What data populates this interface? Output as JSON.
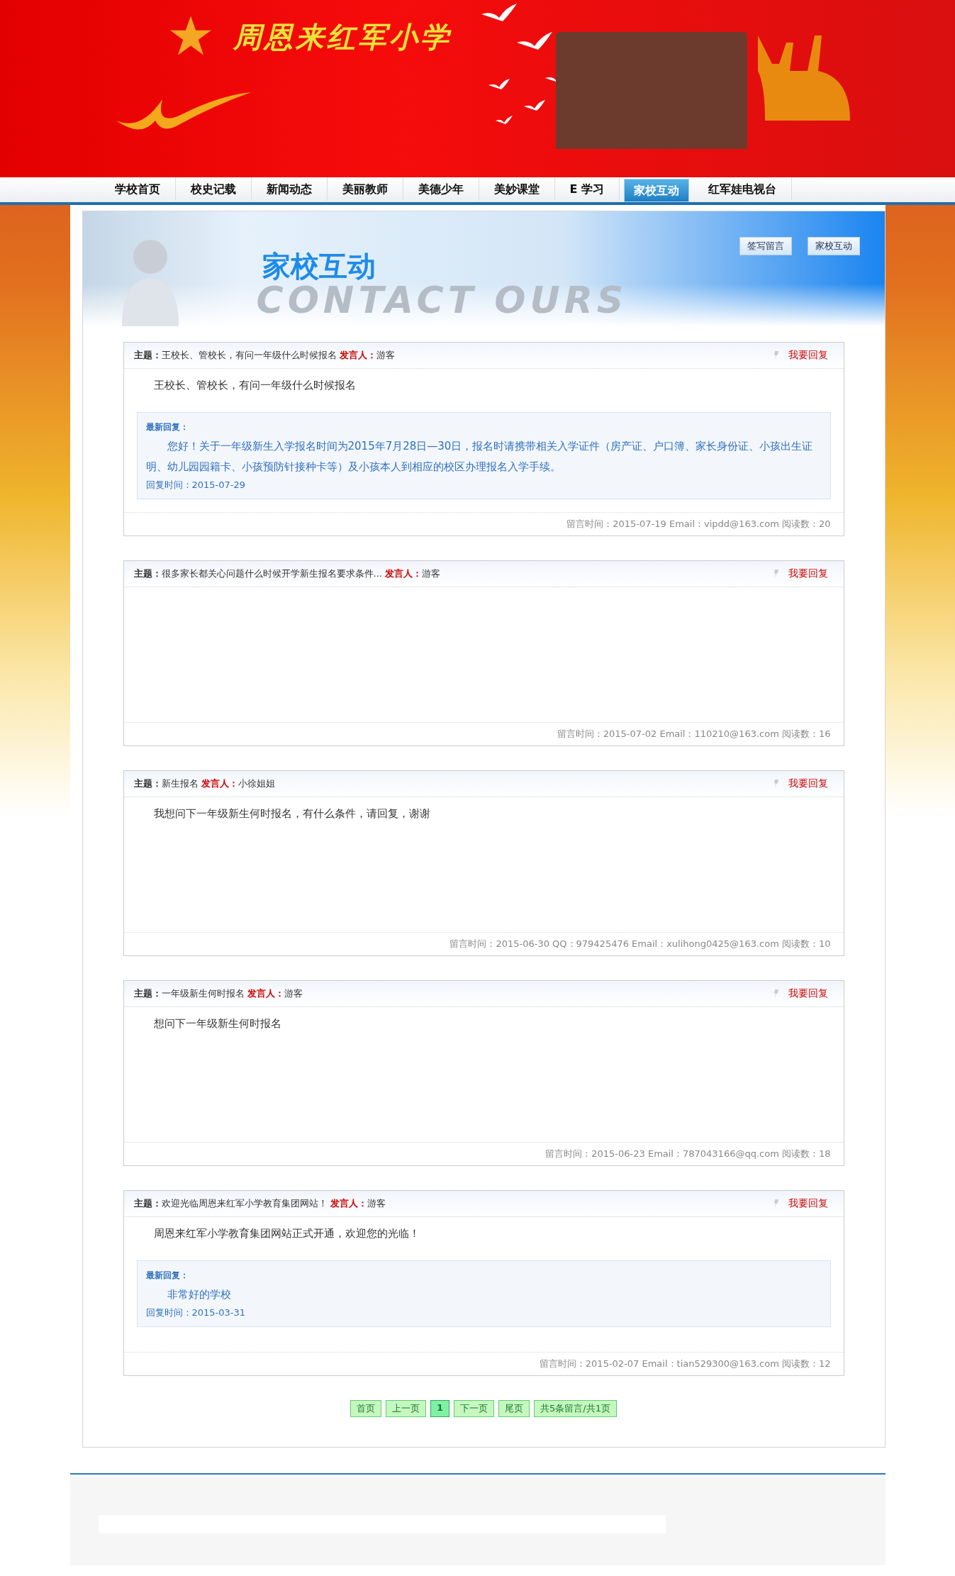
{
  "header": {
    "school_name": "周恩来红军小学"
  },
  "nav": [
    {
      "label": "学校首页",
      "selected": false
    },
    {
      "label": "校史记载",
      "selected": false
    },
    {
      "label": "新闻动态",
      "selected": false
    },
    {
      "label": "美丽教师",
      "selected": false
    },
    {
      "label": "美德少年",
      "selected": false
    },
    {
      "label": "美妙课堂",
      "selected": false
    },
    {
      "label": "E 学习",
      "selected": false
    },
    {
      "label": "家校互动",
      "selected": true
    },
    {
      "label": "红军娃电视台",
      "selected": false
    }
  ],
  "banner": {
    "title": "家校互动",
    "subtitle": "CONTACT  OURS",
    "buttons": [
      "签写留言",
      "家校互动"
    ]
  },
  "posts": [
    {
      "subject_label": "主题：",
      "subject": "王校长、管校长，有问一年级什么时候报名",
      "author_label": "发言人：",
      "author": "游客",
      "reply_link": "我要回复",
      "body": "王校长、管校长，有问一年级什么时候报名",
      "reply": {
        "label": "最新回复：",
        "text": "您好！关于一年级新生入学报名时间为2015年7月28日—30日，报名时请携带相关入学证件（房产证、户口簿、家长身份证、小孩出生证明、幼儿园园籍卡、小孩预防针接种卡等）及小孩本人到相应的校区办理报名入学手续。",
        "time": "回复时间：2015-07-29"
      },
      "meta": "留言时间：2015-07-19 Email：vipdd@163.com 阅读数：20"
    },
    {
      "subject_label": "主题：",
      "subject": "很多家长都关心问题什么时候开学新生报名要求条件...",
      "author_label": "发言人：",
      "author": "游客",
      "reply_link": "我要回复",
      "meta": "留言时间：2015-07-02 Email：110210@163.com 阅读数：16"
    },
    {
      "subject_label": "主题：",
      "subject": "新生报名",
      "author_label": "发言人：",
      "author": "小徐姐姐",
      "reply_link": "我要回复",
      "body": "我想问下一年级新生何时报名，有什么条件，请回复，谢谢",
      "meta": "留言时间：2015-06-30 QQ：979425476 Email：xulihong0425@163.com 阅读数：10"
    },
    {
      "subject_label": "主题：",
      "subject": "一年级新生何时报名",
      "author_label": "发言人：",
      "author": "游客",
      "reply_link": "我要回复",
      "body": "想问下一年级新生何时报名",
      "meta": "留言时间：2015-06-23 Email：787043166@qq.com 阅读数：18"
    },
    {
      "subject_label": "主题：",
      "subject": "欢迎光临周恩来红军小学教育集团网站！",
      "author_label": "发言人：",
      "author": "游客",
      "reply_link": "我要回复",
      "body": "周恩来红军小学教育集团网站正式开通，欢迎您的光临！",
      "reply": {
        "label": "最新回复：",
        "text": "非常好的学校",
        "time": "回复时间：2015-03-31"
      },
      "meta": "留言时间：2015-02-07 Email：tian529300@163.com 阅读数：12"
    }
  ],
  "pagination": [
    {
      "label": "首页",
      "kind": "link",
      "selected": false
    },
    {
      "label": "上一页",
      "kind": "link",
      "selected": false
    },
    {
      "label": "1",
      "kind": "page",
      "selected": true
    },
    {
      "label": "下一页",
      "kind": "link",
      "selected": false
    },
    {
      "label": "尾页",
      "kind": "link",
      "selected": false
    },
    {
      "label": "共5条留言/共1页",
      "kind": "info",
      "selected": false
    }
  ]
}
